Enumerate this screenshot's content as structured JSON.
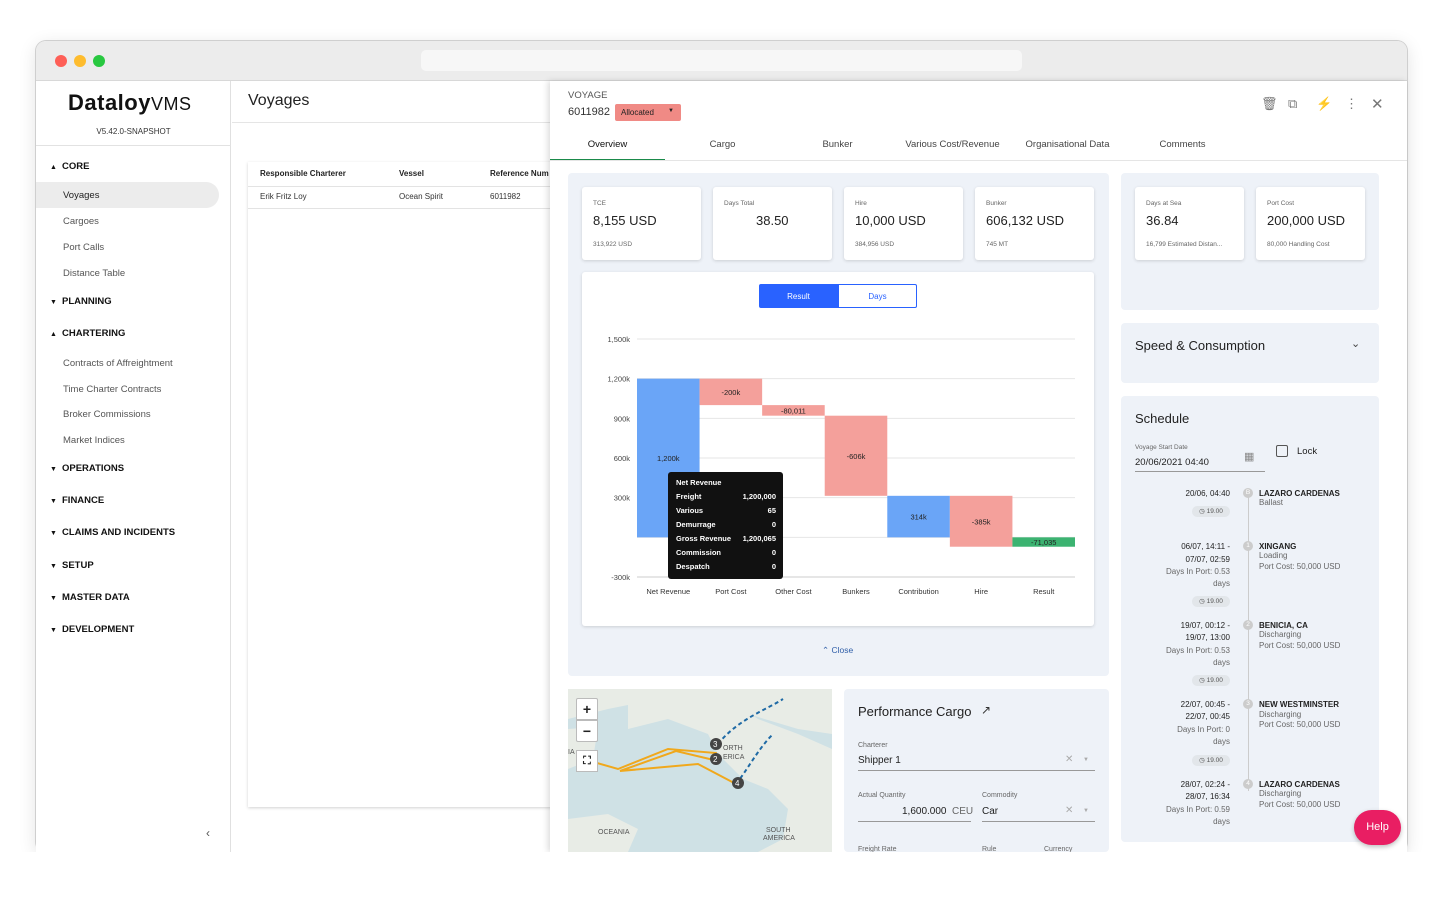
{
  "app": {
    "logo_main": "Dataloy",
    "logo_suffix": "VMS",
    "version": "V5.42.0-SNAPSHOT"
  },
  "sidebar": {
    "sections": [
      {
        "label": "CORE",
        "items": [
          "Voyages",
          "Cargoes",
          "Port Calls",
          "Distance Table"
        ]
      },
      {
        "label": "PLANNING"
      },
      {
        "label": "CHARTERING",
        "items": [
          "Contracts of Affreightment",
          "Time Charter Contracts",
          "Broker Commissions",
          "Market Indices"
        ]
      },
      {
        "label": "OPERATIONS"
      },
      {
        "label": "FINANCE"
      },
      {
        "label": "CLAIMS AND INCIDENTS"
      },
      {
        "label": "SETUP"
      },
      {
        "label": "MASTER DATA"
      },
      {
        "label": "DEVELOPMENT"
      }
    ],
    "collapse_icon": "chevron-left-icon"
  },
  "list": {
    "title": "Voyages",
    "columns": [
      "Responsible Charterer",
      "Vessel",
      "Reference Num"
    ],
    "rows": [
      [
        "Erik Fritz Loy",
        "Ocean Spirit",
        "6011982"
      ]
    ]
  },
  "voyage": {
    "label": "VOYAGE",
    "number": "6011982",
    "status": "Allocated",
    "tabs": [
      "Overview",
      "Cargo",
      "Bunker",
      "Various Cost/Revenue",
      "Organisational Data",
      "Comments"
    ],
    "kpis": [
      {
        "label": "TCE",
        "value": "8,155 USD",
        "sub": "313,922 USD"
      },
      {
        "label": "Days Total",
        "value": "38.50",
        "sub": ""
      },
      {
        "label": "Hire",
        "value": "10,000 USD",
        "sub": "384,956 USD"
      },
      {
        "label": "Bunker",
        "value": "606,132 USD",
        "sub": "745 MT"
      }
    ],
    "kpis_right": [
      {
        "label": "Days at Sea",
        "value": "36.84",
        "sub": "16,799 Estimated Distan..."
      },
      {
        "label": "Port Cost",
        "value": "200,000 USD",
        "sub": "80,000 Handling Cost"
      }
    ],
    "toggle": {
      "result": "Result",
      "days": "Days"
    },
    "close_label": "Close"
  },
  "chart_data": {
    "type": "waterfall",
    "categories": [
      "Net Revenue",
      "Port Cost",
      "Other Cost",
      "Bunkers",
      "Contribution",
      "Hire",
      "Result"
    ],
    "values": [
      1200000,
      -200000,
      -80011,
      -606000,
      314000,
      -385000,
      -71035
    ],
    "bar_labels": [
      "1,200k",
      "-200k",
      "-80,011",
      "-606k",
      "314k",
      "-385k",
      "-71,035"
    ],
    "y_ticks": [
      "1,500k",
      "1,200k",
      "900k",
      "600k",
      "300k",
      "-300k"
    ],
    "y_tick_values": [
      1500000,
      1200000,
      900000,
      600000,
      300000,
      -300000
    ],
    "ylim": [
      -300000,
      1500000
    ],
    "colors": {
      "positive": "#6aa5f7",
      "negative": "#f4a09b",
      "result": "#3cb371"
    },
    "tooltip": {
      "title": "Net Revenue",
      "rows": [
        [
          "Freight",
          "1,200,000"
        ],
        [
          "Various",
          "65"
        ],
        [
          "Demurrage",
          "0"
        ],
        [
          "Gross Revenue",
          "1,200,065"
        ],
        [
          "Commission",
          "0"
        ],
        [
          "Despatch",
          "0"
        ]
      ]
    }
  },
  "map": {
    "labels": [
      "ORTH",
      "ERICA",
      "OCEANIA",
      "SOUTH",
      "AMERICA",
      "IA"
    ],
    "markers": [
      "3",
      "2",
      "4"
    ]
  },
  "performance_cargo": {
    "title": "Performance Cargo",
    "charterer_label": "Charterer",
    "charterer": "Shipper 1",
    "qty_label": "Actual Quantity",
    "qty": "1,600.000",
    "qty_unit": "CEU",
    "commodity_label": "Commodity",
    "commodity": "Car",
    "freight_rate_label": "Freight Rate",
    "rule_label": "Rule",
    "currency_label": "Currency"
  },
  "speed": {
    "title": "Speed & Consumption"
  },
  "schedule": {
    "title": "Schedule",
    "start_label": "Voyage Start Date",
    "start_value": "20/06/2021 04:40",
    "lock_label": "Lock",
    "entries": [
      {
        "idx": "B",
        "date1": "20/06, 04:40",
        "date2": "",
        "days": "",
        "port": "LAZARO CARDENAS",
        "type": "Ballast",
        "cost": "",
        "speed": "19.00"
      },
      {
        "idx": "1",
        "date1": "06/07, 14:11 -",
        "date2": "07/07, 02:59",
        "days": "Days In Port: 0.53",
        "days2": "days",
        "port": "XINGANG",
        "type": "Loading",
        "cost": "Port Cost: 50,000 USD",
        "speed": "19.00"
      },
      {
        "idx": "2",
        "date1": "19/07, 00:12 -",
        "date2": "19/07, 13:00",
        "days": "Days In Port: 0.53",
        "days2": "days",
        "port": "BENICIA, CA",
        "type": "Discharging",
        "cost": "Port Cost: 50,000 USD",
        "speed": "19.00"
      },
      {
        "idx": "3",
        "date1": "22/07, 00:45 -",
        "date2": "22/07, 00:45",
        "days": "Days In Port: 0",
        "days2": "days",
        "port": "NEW WESTMINSTER",
        "type": "Discharging",
        "cost": "Port Cost: 50,000 USD",
        "speed": "19.00"
      },
      {
        "idx": "4",
        "date1": "28/07, 02:24 -",
        "date2": "28/07, 16:34",
        "days": "Days In Port: 0.59",
        "days2": "days",
        "port": "LAZARO CARDENAS",
        "type": "Discharging",
        "cost": "Port Cost: 50,000 USD",
        "speed": ""
      }
    ]
  },
  "help": "Help"
}
